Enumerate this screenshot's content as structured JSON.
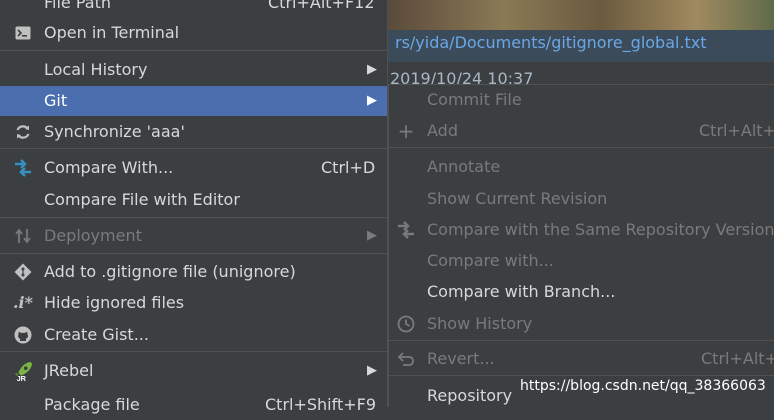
{
  "background": {
    "path_text": "rs/yida/Documents/gitignore_global.txt",
    "date_text": "2019/10/24 10:37"
  },
  "left_menu": {
    "file_path": {
      "label": "File Path",
      "shortcut": "Ctrl+Alt+F12"
    },
    "open_terminal": {
      "label": "Open in Terminal"
    },
    "local_history": {
      "label": "Local History"
    },
    "git": {
      "label": "Git"
    },
    "synchronize": {
      "label": "Synchronize 'aaa'"
    },
    "compare_with": {
      "label": "Compare With...",
      "shortcut": "Ctrl+D"
    },
    "compare_file_editor": {
      "label": "Compare File with Editor"
    },
    "deployment": {
      "label": "Deployment"
    },
    "add_gitignore": {
      "label": "Add to .gitignore file (unignore)"
    },
    "hide_ignored": {
      "label": "Hide ignored files"
    },
    "create_gist": {
      "label": "Create Gist..."
    },
    "jrebel": {
      "label": "JRebel"
    },
    "package_file": {
      "label": "Package file",
      "shortcut": "Ctrl+Shift+F9"
    }
  },
  "git_submenu": {
    "commit_file": {
      "label": "Commit File"
    },
    "add": {
      "label": "Add",
      "shortcut": "Ctrl+Alt+"
    },
    "annotate": {
      "label": "Annotate"
    },
    "show_current_revision": {
      "label": "Show Current Revision"
    },
    "compare_same_repo": {
      "label": "Compare with the Same Repository Version"
    },
    "compare_with": {
      "label": "Compare with..."
    },
    "compare_branch": {
      "label": "Compare with Branch..."
    },
    "show_history": {
      "label": "Show History"
    },
    "revert": {
      "label": "Revert...",
      "shortcut": "Ctrl+Alt+"
    },
    "repository": {
      "label": "Repository"
    }
  },
  "watermark": "https://blog.csdn.net/qq_38366063",
  "colors": {
    "menu_bg": "#3c3f41",
    "selected": "#4b6eaf",
    "disabled_text": "#7a7a7a",
    "link": "#6aa7e6"
  }
}
